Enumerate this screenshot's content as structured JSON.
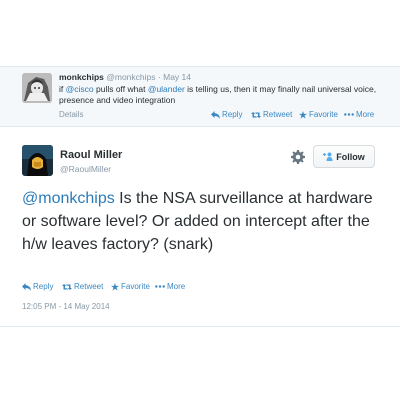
{
  "parent_tweet": {
    "name": "monkchips",
    "handle": "@monkchips",
    "separator": "·",
    "date": "May 14",
    "text_pre": "if ",
    "mention1": "@cisco",
    "text_mid": " pulls off what ",
    "mention2": "@ulander",
    "text_post": " is telling us, then it may finally nail universal voice, presence and video integration",
    "details_label": "Details",
    "actions": {
      "reply": "Reply",
      "retweet": "Retweet",
      "favorite": "Favorite",
      "more": "More"
    }
  },
  "main_tweet": {
    "name": "Raoul Miller",
    "handle": "@RaoulMiller",
    "follow_label": "Follow",
    "mention": "@monkchips",
    "text": " Is the NSA surveillance at hardware or software level? Or added on intercept after the h/w leaves factory? (snark)",
    "actions": {
      "reply": "Reply",
      "retweet": "Retweet",
      "favorite": "Favorite",
      "more": "More"
    },
    "timestamp": "12:05 PM - 14 May 2014"
  },
  "colors": {
    "link": "#2b7bb9",
    "action": "#3b88c3",
    "muted": "#8899a6",
    "text": "#292f33"
  },
  "icons": [
    "reply-icon",
    "retweet-icon",
    "favorite-icon",
    "more-icon",
    "gear-icon",
    "follow-person-icon"
  ]
}
